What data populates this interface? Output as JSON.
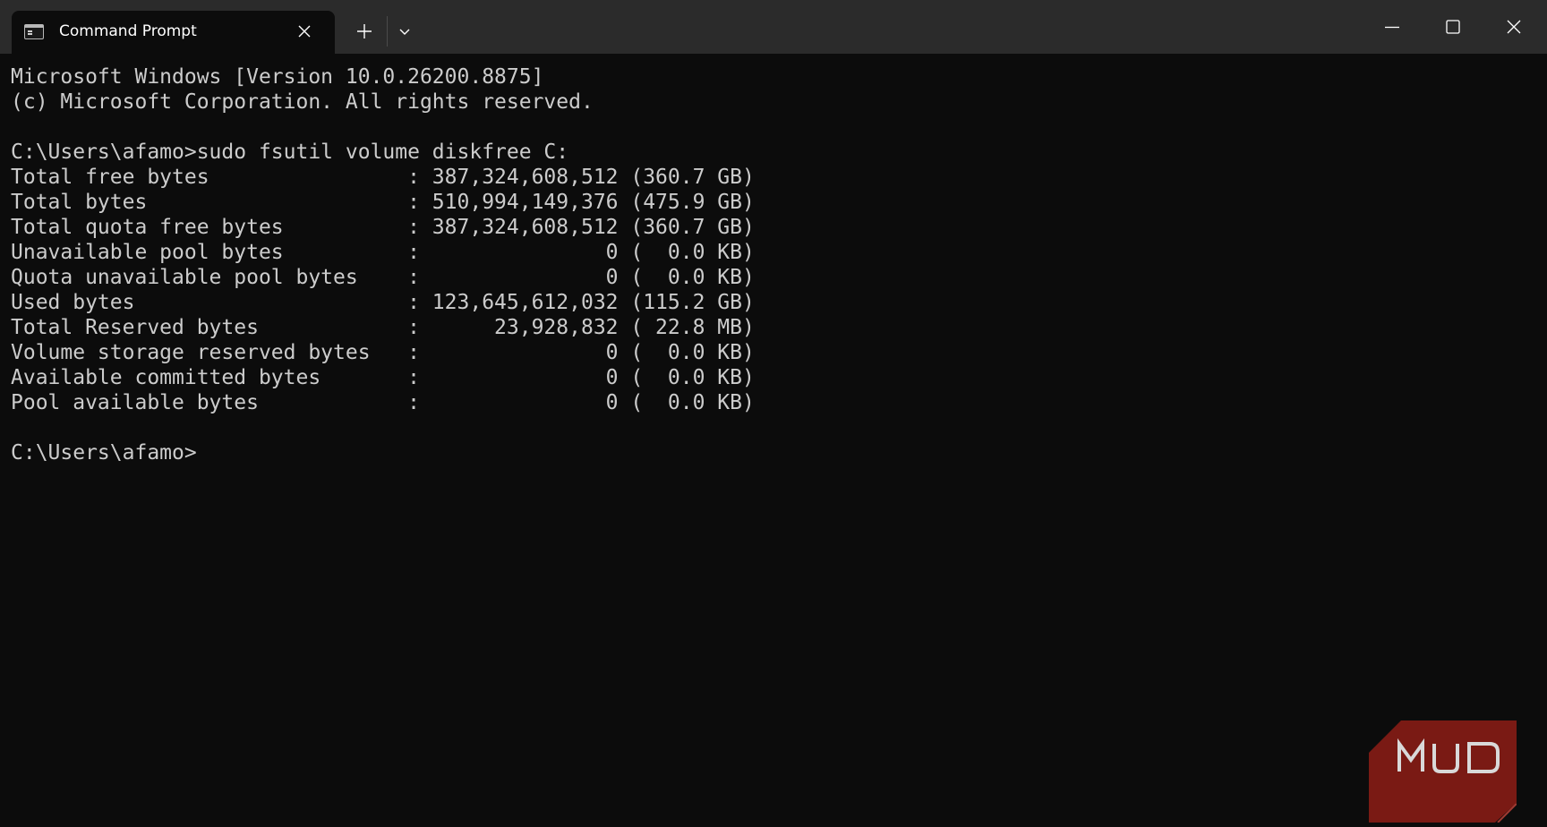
{
  "window": {
    "tab_title": "Command Prompt",
    "icons": {
      "tab_icon": "terminal-icon",
      "tab_close": "close-icon",
      "new_tab": "plus-icon",
      "dropdown": "chevron-down-icon",
      "minimize": "minimize-icon",
      "maximize": "maximize-icon",
      "close": "close-icon"
    }
  },
  "terminal": {
    "lines": [
      "Microsoft Windows [Version 10.0.26200.8875]",
      "(c) Microsoft Corporation. All rights reserved.",
      "",
      "C:\\Users\\afamo>sudo fsutil volume diskfree C:",
      "Total free bytes                : 387,324,608,512 (360.7 GB)",
      "Total bytes                     : 510,994,149,376 (475.9 GB)",
      "Total quota free bytes          : 387,324,608,512 (360.7 GB)",
      "Unavailable pool bytes          :               0 (  0.0 KB)",
      "Quota unavailable pool bytes    :               0 (  0.0 KB)",
      "Used bytes                      : 123,645,612,032 (115.2 GB)",
      "Total Reserved bytes            :      23,928,832 ( 22.8 MB)",
      "Volume storage reserved bytes   :               0 (  0.0 KB)",
      "Available committed bytes       :               0 (  0.0 KB)",
      "Pool available bytes            :               0 (  0.0 KB)",
      "",
      "C:\\Users\\afamo>"
    ]
  },
  "watermark": {
    "text": "MUO",
    "color": "#7a1a14"
  },
  "colors": {
    "titlebar": "#2b2b2b",
    "terminal_bg": "#0c0c0c",
    "terminal_fg": "#cccccc"
  }
}
